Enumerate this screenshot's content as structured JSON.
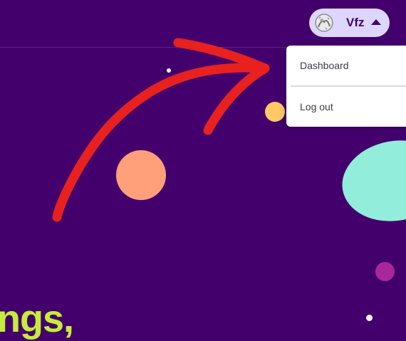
{
  "header": {
    "user_menu": {
      "username": "Vfz",
      "avatar_icon": "avatar-icon",
      "caret_icon": "caret-up-icon"
    }
  },
  "dropdown": {
    "items": [
      {
        "label": "Dashboard"
      },
      {
        "label": "Log out"
      }
    ]
  },
  "hero": {
    "text_fragment": "ngs,"
  },
  "colors": {
    "background": "#43006d",
    "user_button": "#ddd6ff",
    "annotation_arrow": "#e8211f",
    "hero_text": "#c6ec3a"
  }
}
